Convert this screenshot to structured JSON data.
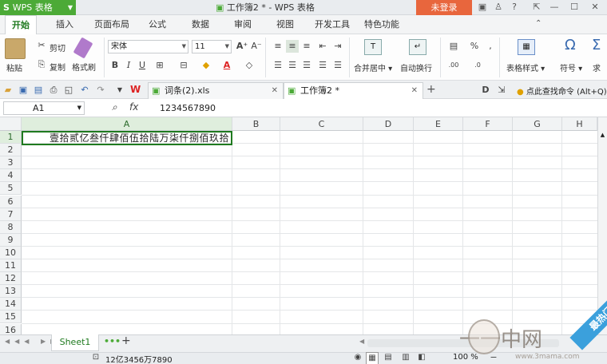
{
  "app": {
    "name": "WPS 表格",
    "doc_title": "工作簿2 * - WPS 表格",
    "login_label": "未登录"
  },
  "menu": [
    "开始",
    "插入",
    "页面布局",
    "公式",
    "数据",
    "审阅",
    "视图",
    "开发工具",
    "特色功能"
  ],
  "ribbon": {
    "paste": "粘贴",
    "cut": "剪切",
    "copy": "复制",
    "format_painter": "格式刷",
    "font_name": "宋体",
    "font_size": "11",
    "merge_center": "合并居中",
    "wrap_text": "自动换行",
    "table_style": "表格样式",
    "symbol": "符号",
    "sum": "求"
  },
  "doc_tabs": [
    {
      "label": "词条(2).xls",
      "selected": false
    },
    {
      "label": "工作簿2 *",
      "selected": true
    }
  ],
  "search_cmd": "点此查找命令 (Alt+Q)",
  "formula_bar": {
    "name_box": "A1",
    "fx": "fx",
    "value": "1234567890"
  },
  "columns": [
    "A",
    "B",
    "C",
    "D",
    "E",
    "F",
    "G",
    "H"
  ],
  "rows": [
    "1",
    "2",
    "3",
    "4",
    "5",
    "6",
    "7",
    "8",
    "9",
    "10",
    "11",
    "12",
    "13",
    "14",
    "15",
    "16"
  ],
  "cell_a1": "壹拾贰亿叁仟肆佰伍拾陆万柒仟捌佰玖拾",
  "sheet_tab": "Sheet1",
  "status": {
    "sum_text": "12亿3456万7890",
    "zoom": "100 %"
  },
  "watermark": {
    "text": "一一中网",
    "url": "www.3mama.com",
    "corner": "最热门"
  }
}
